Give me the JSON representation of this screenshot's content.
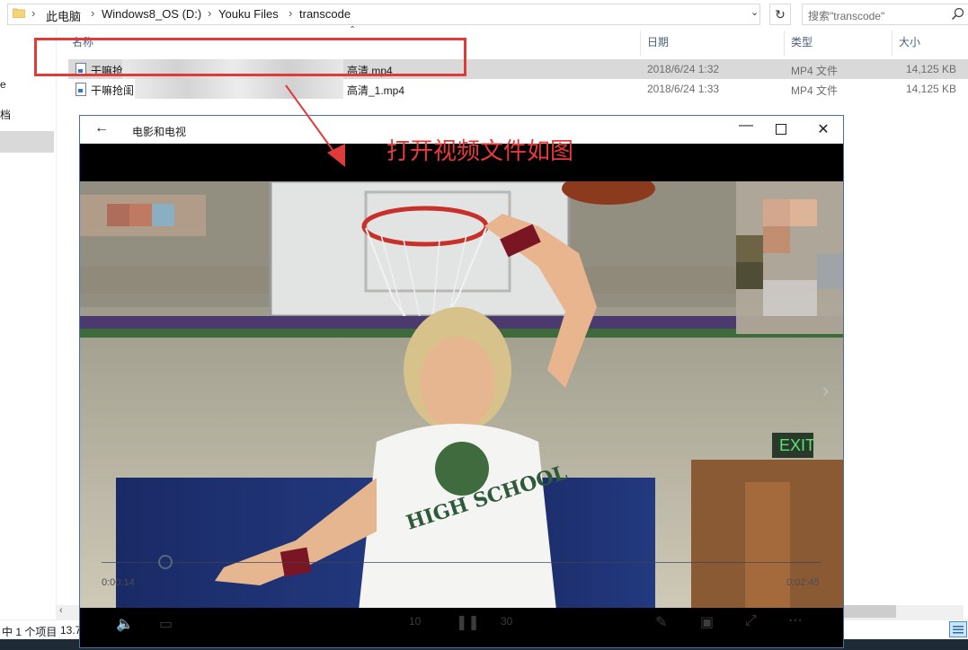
{
  "explorer": {
    "breadcrumbs": [
      "此电脑",
      "Windows8_OS (D:)",
      "Youku Files",
      "transcode"
    ],
    "search_placeholder": "搜索\"transcode\"",
    "nav_items": [
      "e",
      "档"
    ],
    "columns": {
      "name": "名称",
      "date": "日期",
      "type": "类型",
      "size": "大小"
    },
    "files": [
      {
        "name_start": "干嘛抢",
        "name_end": "高清.mp4",
        "date": "2018/6/24 1:32",
        "type": "MP4 文件",
        "size": "14,125 KB",
        "selected": true
      },
      {
        "name_start": "干嘛抢闺",
        "name_end": "高清_1.mp4",
        "date": "2018/6/24 1:33",
        "type": "MP4 文件",
        "size": "14,125 KB",
        "selected": false
      }
    ],
    "status_text": "中 1 个项目",
    "status_size": "13.7"
  },
  "annotation": {
    "text": "打开视频文件如图",
    "color": "#e83a3a"
  },
  "player": {
    "app_title": "电影和电视",
    "elapsed": "0:00:14",
    "remaining": "0:02:45",
    "progress_fraction": 0.087,
    "skip_back": "10",
    "skip_forward": "30"
  }
}
